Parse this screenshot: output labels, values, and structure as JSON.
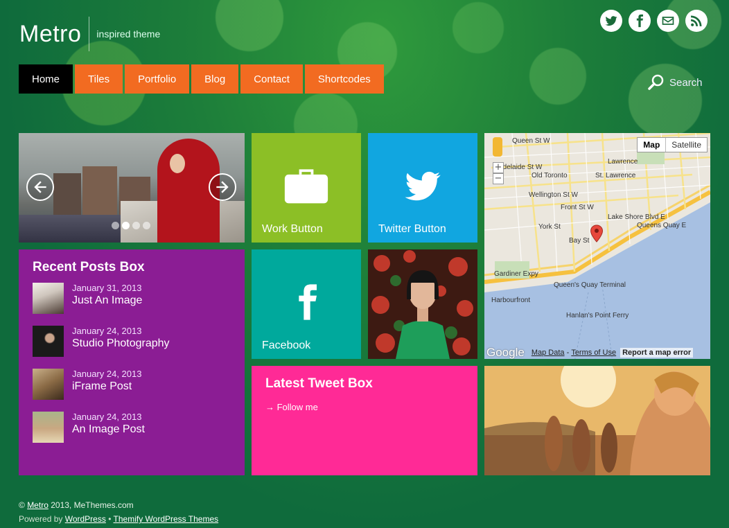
{
  "site": {
    "logo": "Metro",
    "tagline": "inspired theme"
  },
  "social": [
    "twitter-icon",
    "facebook-icon",
    "email-icon",
    "rss-icon"
  ],
  "nav": [
    "Home",
    "Tiles",
    "Portfolio",
    "Blog",
    "Contact",
    "Shortcodes"
  ],
  "nav_active": "Home",
  "search": {
    "label": "Search"
  },
  "tiles": {
    "work": {
      "label": "Work Button",
      "color": "#8cbf26"
    },
    "twitter": {
      "label": "Twitter Button",
      "color": "#11a6e0"
    },
    "facebook": {
      "label": "Facebook",
      "color": "#00a99c"
    }
  },
  "slider": {
    "dots": 4,
    "active_dot": 2
  },
  "recent_posts": {
    "title": "Recent Posts Box",
    "items": [
      {
        "date": "January 31, 2013",
        "title": "Just An Image"
      },
      {
        "date": "January 24, 2013",
        "title": "Studio Photography"
      },
      {
        "date": "January 24, 2013",
        "title": "iFrame Post"
      },
      {
        "date": "January 24, 2013",
        "title": "An Image Post"
      }
    ]
  },
  "tweet_box": {
    "title": "Latest Tweet Box",
    "follow": "→ Follow me"
  },
  "map": {
    "type_map": "Map",
    "type_satellite": "Satellite",
    "labels": [
      "Queen St W",
      "Adelaide St W",
      "Old Toronto",
      "Lawrence",
      "St. Lawrence",
      "Wellington St W",
      "Front St W",
      "Lake Shore Blvd E",
      "Queens Quay E",
      "Gardiner Expy",
      "Queen's Quay Terminal",
      "Harbourfront",
      "Bay St",
      "York St",
      "Hanlan's Point Ferry"
    ],
    "google": "Google",
    "map_data": "Map Data",
    "terms": "Terms of Use",
    "report": "Report a map error"
  },
  "footer": {
    "copyright": "©",
    "site_link": "Metro",
    "year_text": "2013,",
    "company": "MeThemes.com",
    "powered_by": "Powered by",
    "wordpress_link": "WordPress",
    "bullet": "•",
    "themify_link": "Themify WordPress Themes"
  },
  "colors": {
    "background": "#0f6b3c",
    "nav_orange": "#f26b21",
    "nav_active": "#000000",
    "posts_purple": "#8b1d94",
    "tweet_pink": "#ff2a96"
  }
}
